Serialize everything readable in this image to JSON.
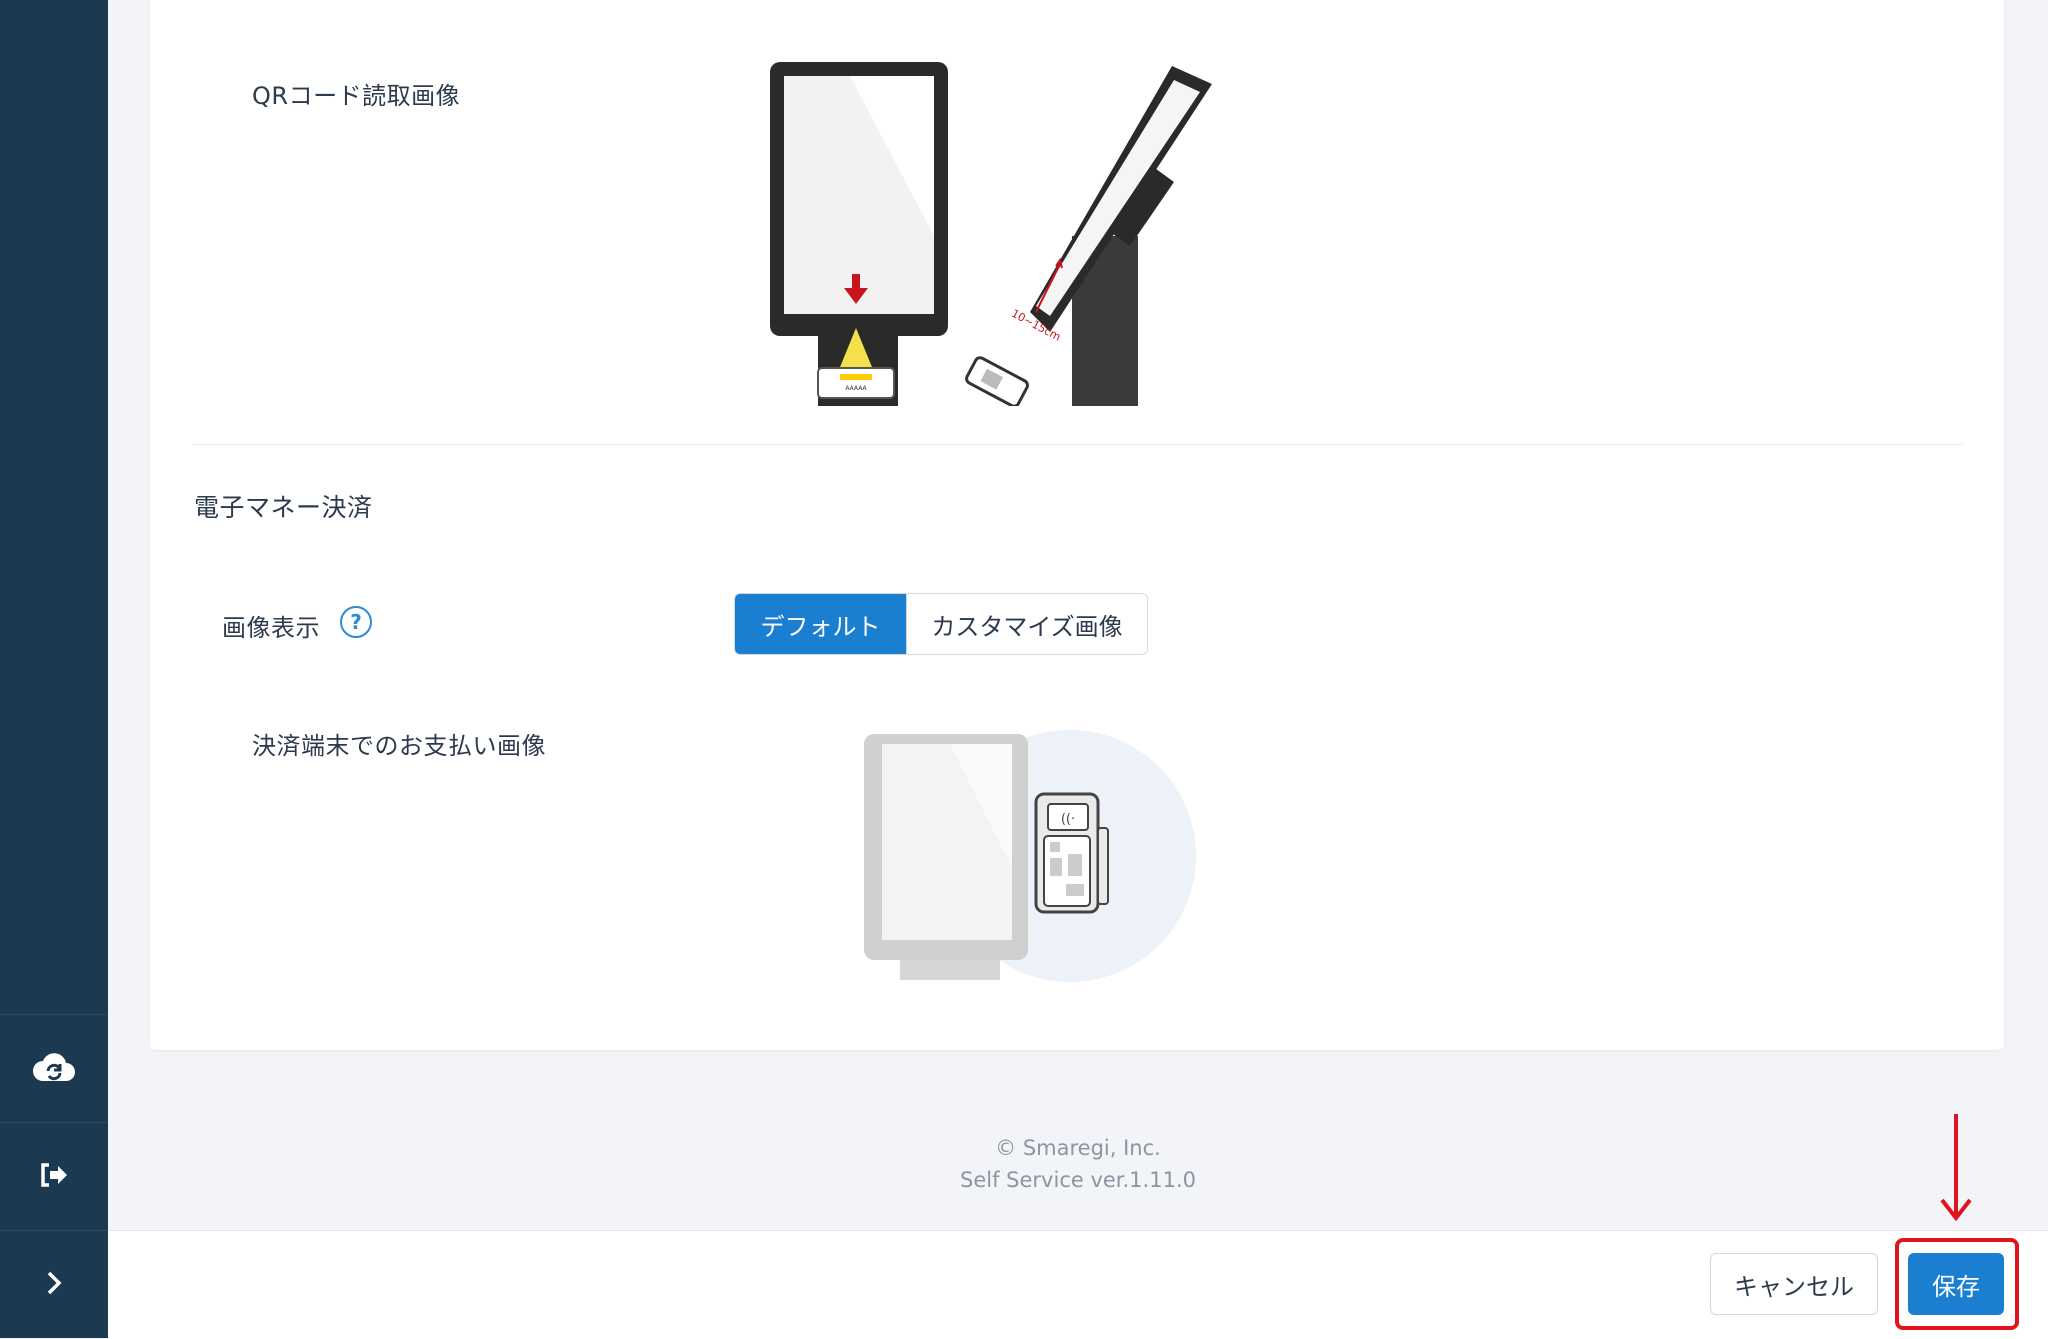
{
  "qr_section": {
    "image_label": "QRコード読取画像",
    "measure_label": "10~15cm"
  },
  "emoney_section": {
    "title": "電子マネー決済",
    "display_label": "画像表示",
    "help_glyph": "?",
    "toggle": {
      "options": [
        "デフォルト",
        "カスタマイズ画像"
      ],
      "selected": "デフォルト"
    },
    "image_label": "決済端末でのお支払い画像"
  },
  "footer": {
    "copyright": "© Smaregi, Inc.",
    "version": "Self Service ver.1.11.0"
  },
  "actions": {
    "cancel_label": "キャンセル",
    "save_label": "保存"
  },
  "sidebar": {
    "icons": [
      "cloud-sync-icon",
      "logout-icon",
      "chevron-right-icon"
    ]
  },
  "colors": {
    "sidebar_bg": "#1b3a52",
    "primary": "#1b7fd1",
    "annotation_red": "#e0141e"
  }
}
